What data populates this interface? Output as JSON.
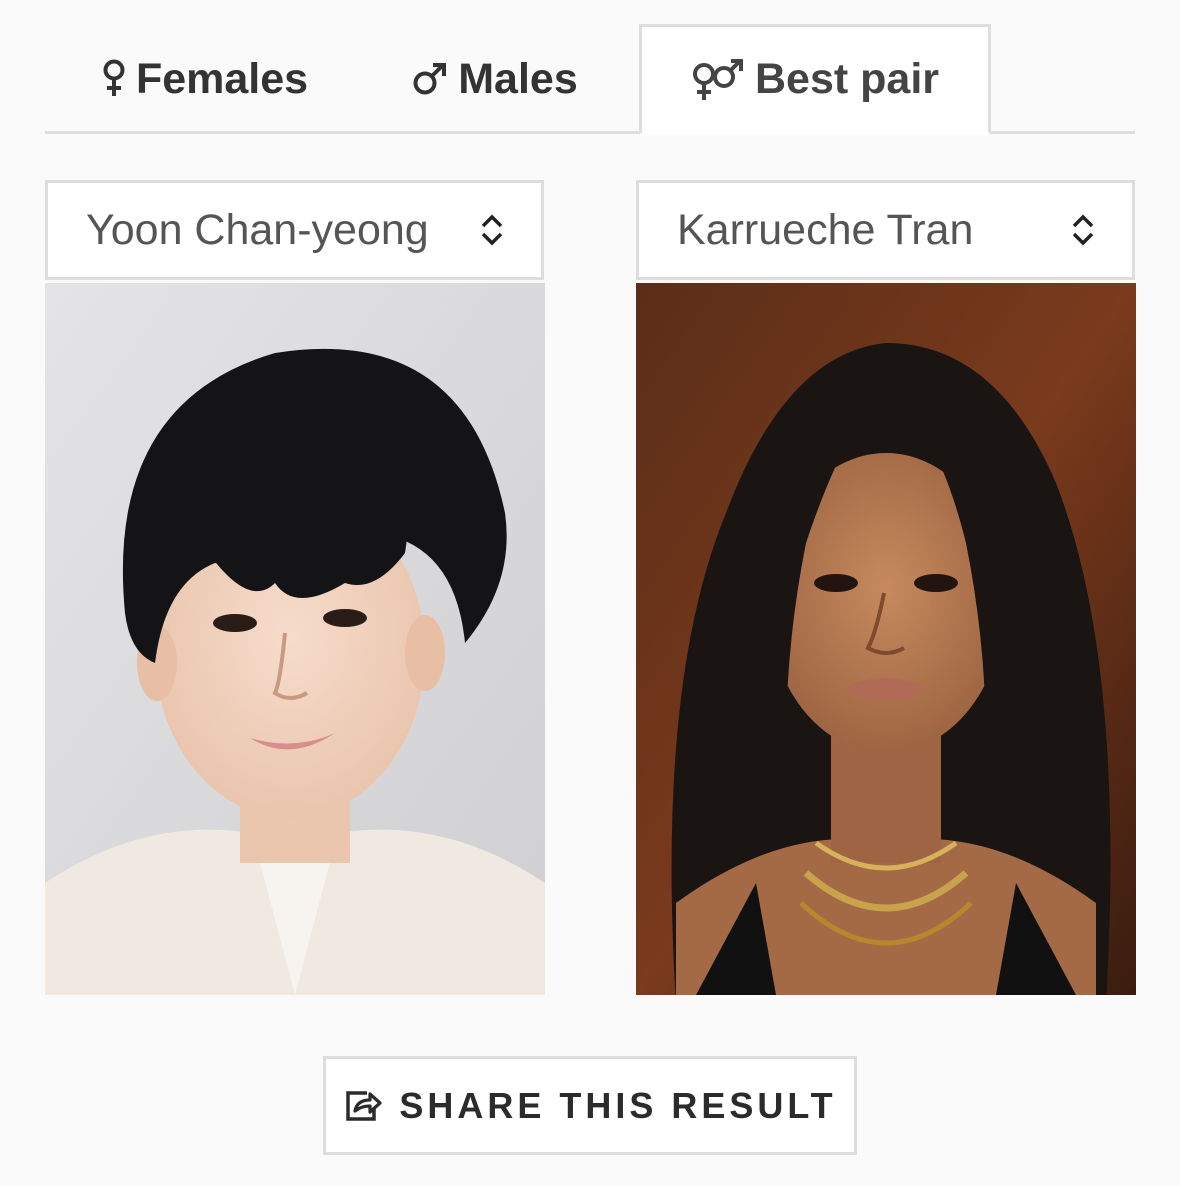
{
  "tabs": [
    {
      "label": "Females",
      "icon": "female-icon",
      "active": false
    },
    {
      "label": "Males",
      "icon": "male-icon",
      "active": false
    },
    {
      "label": "Best pair",
      "icon": "gender-pair-icon",
      "active": true
    }
  ],
  "selects": {
    "left": {
      "value": "Yoon Chan-yeong",
      "icon": "select-caret-icon"
    },
    "right": {
      "value": "Karrueche Tran",
      "icon": "select-caret-icon"
    }
  },
  "photos": {
    "left": {
      "subject": "Yoon Chan-yeong portrait photo"
    },
    "right": {
      "subject": "Karrueche Tran portrait photo"
    }
  },
  "share": {
    "label": "SHARE THIS RESULT",
    "icon": "share-icon"
  },
  "colors": {
    "background": "#fafafa",
    "border": "#dddddd",
    "text": "#333333",
    "active_tab_bg": "#ffffff"
  }
}
